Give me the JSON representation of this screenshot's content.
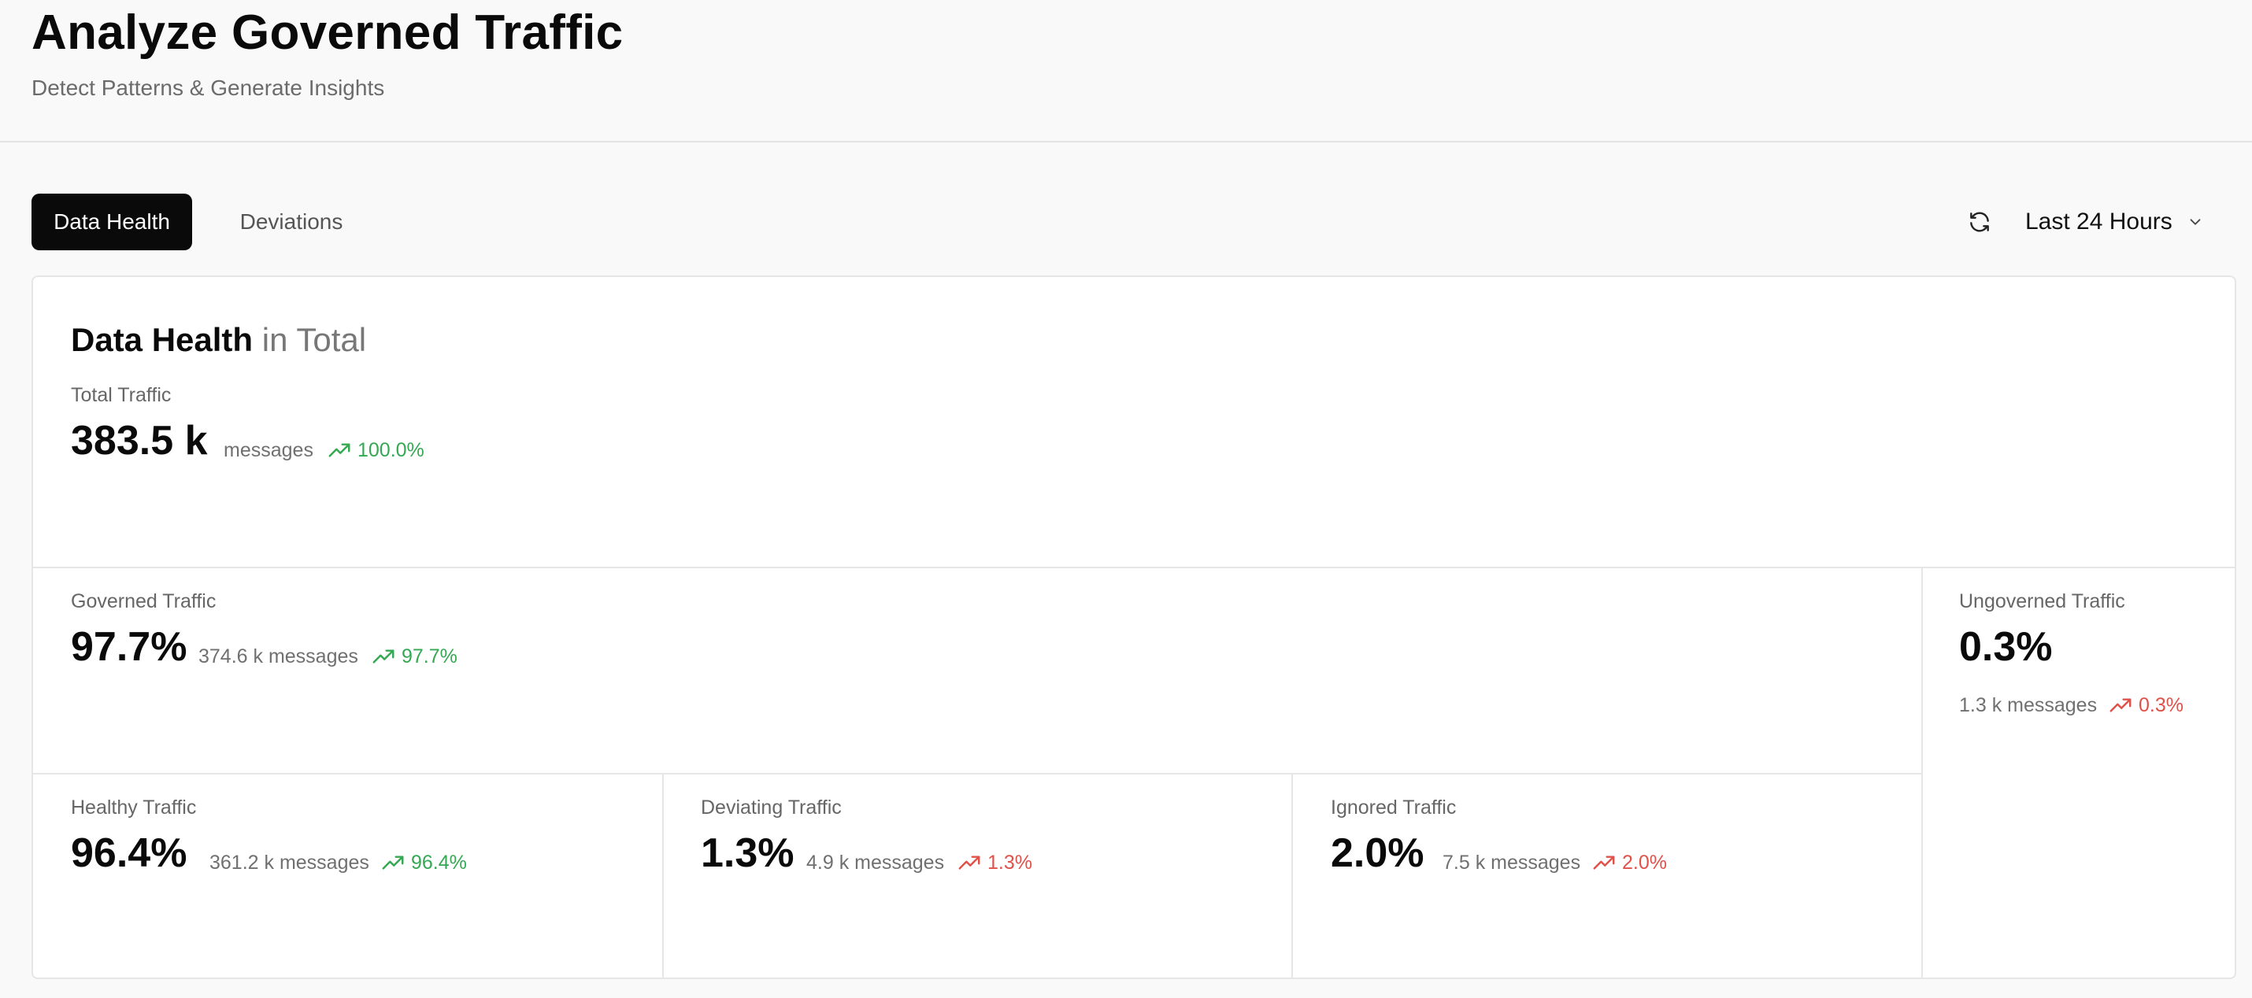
{
  "header": {
    "title": "Analyze Governed Traffic",
    "subtitle": "Detect Patterns & Generate Insights"
  },
  "tabs": [
    {
      "label": "Data Health",
      "active": true
    },
    {
      "label": "Deviations",
      "active": false
    }
  ],
  "controls": {
    "refresh_icon": "refresh-icon",
    "time_range": "Last 24 Hours"
  },
  "card": {
    "title_strong": "Data Health",
    "title_muted": " in Total",
    "total": {
      "label": "Total Traffic",
      "value": "383.5 k",
      "unit": "messages",
      "trend": "100.0%",
      "trend_direction": "up"
    },
    "governed": {
      "label": "Governed Traffic",
      "value": "97.7%",
      "messages": "374.6 k messages",
      "trend": "97.7%",
      "trend_direction": "up"
    },
    "ungoverned": {
      "label": "Ungoverned Traffic",
      "value": "0.3%",
      "messages": "1.3 k messages",
      "trend": "0.3%",
      "trend_direction": "up-negative"
    },
    "healthy": {
      "label": "Healthy Traffic",
      "value": "96.4%",
      "messages": "361.2 k messages",
      "trend": "96.4%",
      "trend_direction": "up"
    },
    "deviating": {
      "label": "Deviating Traffic",
      "value": "1.3%",
      "messages": "4.9 k messages",
      "trend": "1.3%",
      "trend_direction": "up-negative"
    },
    "ignored": {
      "label": "Ignored Traffic",
      "value": "2.0%",
      "messages": "7.5 k messages",
      "trend": "2.0%",
      "trend_direction": "up-negative"
    }
  },
  "colors": {
    "positive": "#34a853",
    "negative": "#e0514a",
    "active_tab": "#0a0a0a"
  }
}
